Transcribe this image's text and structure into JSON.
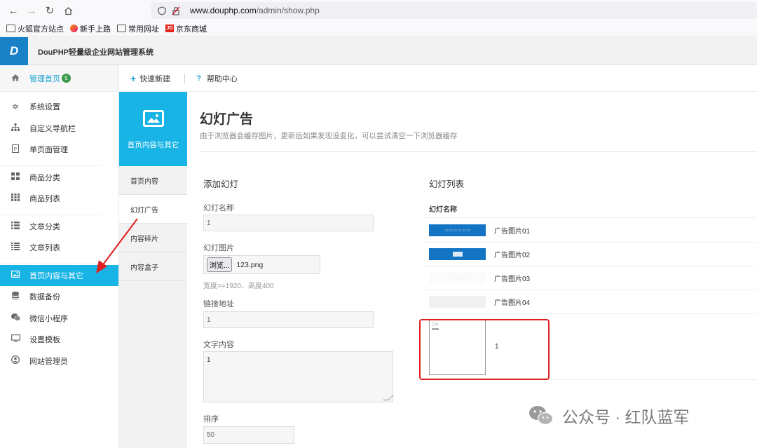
{
  "browser": {
    "url_domain": "www.douphp.com",
    "url_path": "/admin/show.php",
    "bookmarks": [
      "火狐官方站点",
      "新手上路",
      "常用网址",
      "京东商城"
    ],
    "jd_logo": "JD"
  },
  "app": {
    "logo": "D",
    "title": "DouPHP轻量级企业网站管理系统"
  },
  "sidebar": {
    "home": {
      "label": "管理首页",
      "badge": "5"
    },
    "items": [
      {
        "label": "系统设置",
        "icon": "gear-icon"
      },
      {
        "label": "自定义导航栏",
        "icon": "sitemap-icon"
      },
      {
        "label": "单页面管理",
        "icon": "page-icon"
      },
      {
        "label": "商品分类",
        "icon": "grid-icon"
      },
      {
        "label": "商品列表",
        "icon": "grid-list-icon"
      },
      {
        "label": "文章分类",
        "icon": "list-icon"
      },
      {
        "label": "文章列表",
        "icon": "list-icon"
      },
      {
        "label": "首页内容与其它",
        "icon": "image-icon",
        "active": true
      },
      {
        "label": "数据备份",
        "icon": "database-icon"
      },
      {
        "label": "微信小程序",
        "icon": "wechat-icon"
      },
      {
        "label": "设置模板",
        "icon": "monitor-icon"
      },
      {
        "label": "网站管理员",
        "icon": "user-icon"
      }
    ]
  },
  "topbar": {
    "quick_new": "快速新建",
    "help": "帮助中心"
  },
  "submenu": {
    "head_label": "首页内容与其它",
    "items": [
      "首页内容",
      "幻灯广告",
      "内容碎片",
      "内容盒子"
    ],
    "active_index": 1
  },
  "content": {
    "title": "幻灯广告",
    "subtitle": "由于浏览器会缓存图片，更新后如果发现没变化，可以尝试清空一下浏览器缓存",
    "form": {
      "heading": "添加幻灯",
      "name_label": "幻灯名称",
      "name_value": "1",
      "image_label": "幻灯图片",
      "browse_button": "浏览...",
      "file_name": "123.png",
      "size_hint": "宽度>=1920、高度400",
      "link_label": "链接地址",
      "link_value": "1",
      "text_label": "文字内容",
      "text_value": "1",
      "sort_label": "排序",
      "sort_value": "50"
    },
    "list": {
      "heading": "幻灯列表",
      "column": "幻灯名称",
      "rows": [
        "广告图片01",
        "广告图片02",
        "广告图片03",
        "广告图片04"
      ],
      "new_row_name": "1"
    }
  },
  "watermark": "公众号 · 红队蓝军",
  "colors": {
    "accent": "#19b4e6",
    "logo_blue": "#1981c6",
    "badge_green": "#3c9a4b",
    "annotation_red": "#e02020"
  }
}
